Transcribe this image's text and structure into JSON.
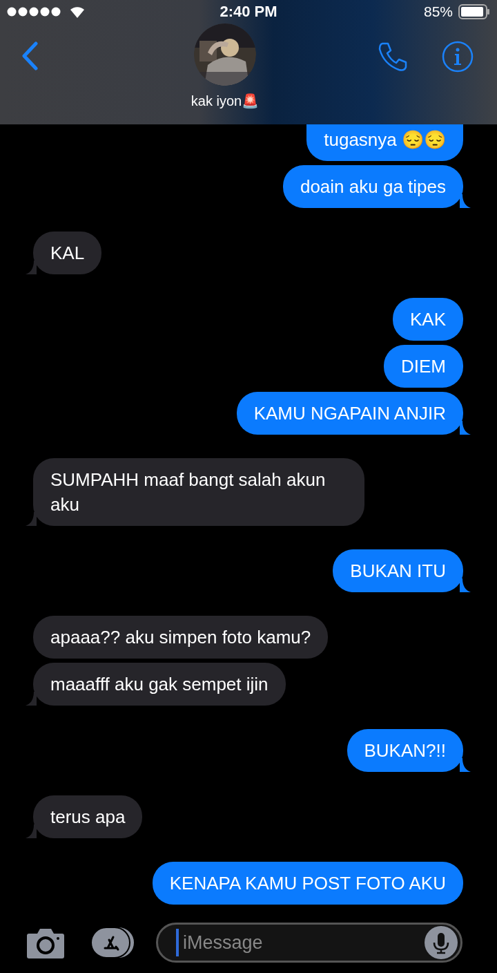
{
  "status_bar": {
    "time": "2:40 PM",
    "battery": "85%"
  },
  "header": {
    "contact_name": "kak iyon🚨"
  },
  "messages": [
    {
      "kind": "sent",
      "text": "tugasnya 😔😔",
      "tail": false
    },
    {
      "kind": "sent",
      "text": "doain aku ga tipes",
      "tail": true
    },
    {
      "kind": "received",
      "text": "KAL",
      "tail": true
    },
    {
      "kind": "sent",
      "text": "KAK",
      "tail": false
    },
    {
      "kind": "sent",
      "text": "DIEM",
      "tail": false
    },
    {
      "kind": "sent",
      "text": "KAMU NGAPAIN ANJIR",
      "tail": true
    },
    {
      "kind": "received",
      "text": "SUMPAHH maaf bangt salah akun aku",
      "tail": true
    },
    {
      "kind": "sent",
      "text": "BUKAN ITU",
      "tail": true
    },
    {
      "kind": "received",
      "text": "apaaa?? aku simpen foto kamu?",
      "tail": false
    },
    {
      "kind": "received",
      "text": "maaafff aku gak sempet ijin",
      "tail": true
    },
    {
      "kind": "sent",
      "text": "BUKAN?!!",
      "tail": true
    },
    {
      "kind": "received",
      "text": "terus apa",
      "tail": true
    },
    {
      "kind": "sent",
      "text": "KENAPA KAMU POST FOTO AKU",
      "tail": false
    }
  ],
  "input": {
    "placeholder": "iMessage"
  }
}
